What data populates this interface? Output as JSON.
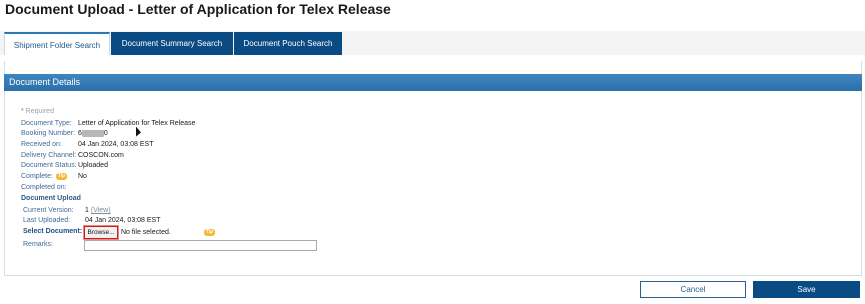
{
  "page": {
    "title": "Document Upload - Letter of Application for Telex Release"
  },
  "tabs": [
    {
      "label": "Shipment Folder Search",
      "active": true
    },
    {
      "label": "Document Summary Search",
      "active": false
    },
    {
      "label": "Document Pouch Search",
      "active": false
    }
  ],
  "panel": {
    "title": "Document Details"
  },
  "form": {
    "required_note": "Required",
    "fields": {
      "document_type": {
        "label": "Document Type:",
        "value": "Letter of Application for Telex Release"
      },
      "booking_number": {
        "label": "Booking Number:",
        "prefix": "6",
        "suffix": "0"
      },
      "received_on": {
        "label": "Received on:",
        "value": "04 Jan 2024, 03:08 EST"
      },
      "delivery_channel": {
        "label": "Delivery Channel:",
        "value": "COSCON.com"
      },
      "document_status": {
        "label": "Document Status:",
        "value": "Uploaded"
      },
      "complete": {
        "label": "Complete:",
        "value": "No"
      },
      "completed_on": {
        "label": "Completed on:",
        "value": ""
      }
    },
    "upload_section": {
      "title": "Document Upload",
      "current_version": {
        "label": "Current Version:",
        "value": "1",
        "link": "(View)"
      },
      "last_uploaded": {
        "label": "Last Uploaded:",
        "value": "04 Jan 2024, 03:08 EST"
      },
      "select_document": {
        "label": "Select Document:",
        "browse": "Browse...",
        "file_status": "No file selected."
      },
      "remarks": {
        "label": "Remarks:",
        "value": ""
      }
    },
    "tip_label": "Tip"
  },
  "actions": {
    "cancel": "Cancel",
    "save": "Save"
  },
  "colors": {
    "header_blue": "#2b6fa9",
    "tab_navy": "#0a4b84",
    "tip_orange": "#f7b733",
    "required_red": "#d9534f"
  }
}
